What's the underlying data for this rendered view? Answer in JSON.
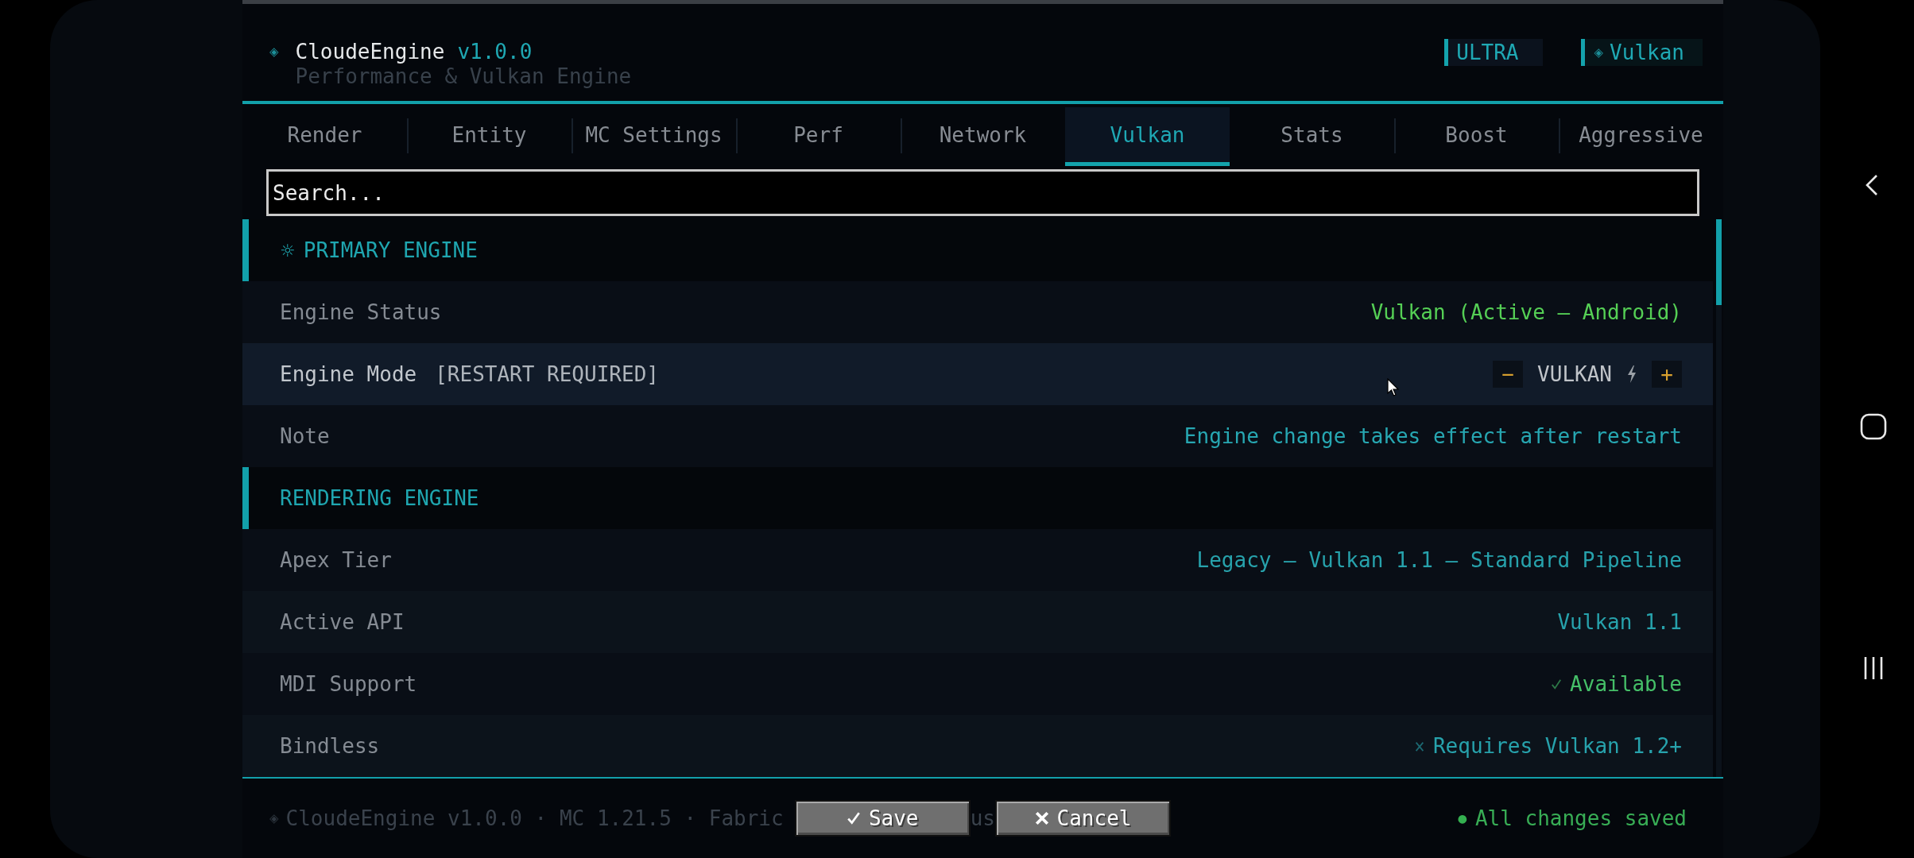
{
  "header": {
    "glyph": "◈",
    "title": "CloudeEngine",
    "version": "v1.0.0",
    "subtitle": "Performance & Vulkan Engine",
    "badges": [
      {
        "kind": "quality",
        "label": "ULTRA"
      },
      {
        "kind": "engine",
        "glyph": "◈",
        "label": "Vulkan"
      }
    ]
  },
  "tabs": [
    {
      "label": "Render",
      "selected": false
    },
    {
      "label": "Entity",
      "selected": false
    },
    {
      "label": "MC Settings",
      "selected": false
    },
    {
      "label": "Perf",
      "selected": false
    },
    {
      "label": "Network",
      "selected": false
    },
    {
      "label": "Vulkan",
      "selected": true
    },
    {
      "label": "Stats",
      "selected": false
    },
    {
      "label": "Boost",
      "selected": false
    },
    {
      "label": "Aggressive",
      "selected": false
    }
  ],
  "search": {
    "placeholder": "Search..."
  },
  "sections": [
    {
      "glyph": "☼",
      "title": "PRIMARY ENGINE",
      "rows": [
        {
          "kind": "info",
          "label": "Engine Status",
          "value": "Vulkan (Active — Android)",
          "color": "#55cf55",
          "highlighted": false
        },
        {
          "kind": "stepper",
          "label": "Engine Mode",
          "tag": "[RESTART REQUIRED]",
          "decrement": "−",
          "value": "VULKAN",
          "increment": "+",
          "highlighted": true
        },
        {
          "kind": "info",
          "label": "Note",
          "value": "Engine change takes effect after restart",
          "color": "#27a7b2",
          "highlighted": false
        }
      ]
    },
    {
      "title": "RENDERING ENGINE",
      "rows": [
        {
          "kind": "info",
          "label": "Apex Tier",
          "value": "Legacy — Vulkan 1.1 — Standard Pipeline",
          "color": "#27a2ac",
          "highlighted": false
        },
        {
          "kind": "info",
          "label": "Active API",
          "value": "Vulkan 1.1",
          "color": "#27a2ac",
          "highlighted": false
        },
        {
          "kind": "info",
          "label": "MDI Support",
          "value": "Available",
          "available": true,
          "color": "#45bf68",
          "highlighted": false
        },
        {
          "kind": "info",
          "label": "Bindless",
          "value": "Requires Vulkan 1.2+",
          "available": false,
          "color": "#27a2ac",
          "highlighted": false
        }
      ]
    }
  ],
  "footer": {
    "glyph": "◈",
    "meta": "CloudeEngine v1.0.0 · MC 1.21.5 · Fabric",
    "items": [
      {
        "kind": "confirm",
        "label": "Save"
      },
      {
        "kind": "text",
        "text": "us"
      },
      {
        "kind": "cancel",
        "label": "Cancel"
      }
    ],
    "status": {
      "glyph": "●",
      "text": "All changes saved"
    }
  }
}
